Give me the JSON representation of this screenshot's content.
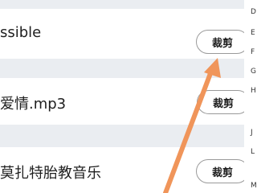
{
  "items": [
    {
      "name": "ssible",
      "action": "裁剪"
    },
    {
      "name": "爱情.mp3",
      "action": "裁剪"
    },
    {
      "name": "莫扎特胎教音乐",
      "action": "裁剪"
    }
  ],
  "side_index": [
    "D",
    "E",
    "F",
    "G",
    "H",
    "J",
    "L",
    "M"
  ],
  "colors": {
    "annotation_arrow": "#f0955a",
    "background": "#eaedf1"
  }
}
